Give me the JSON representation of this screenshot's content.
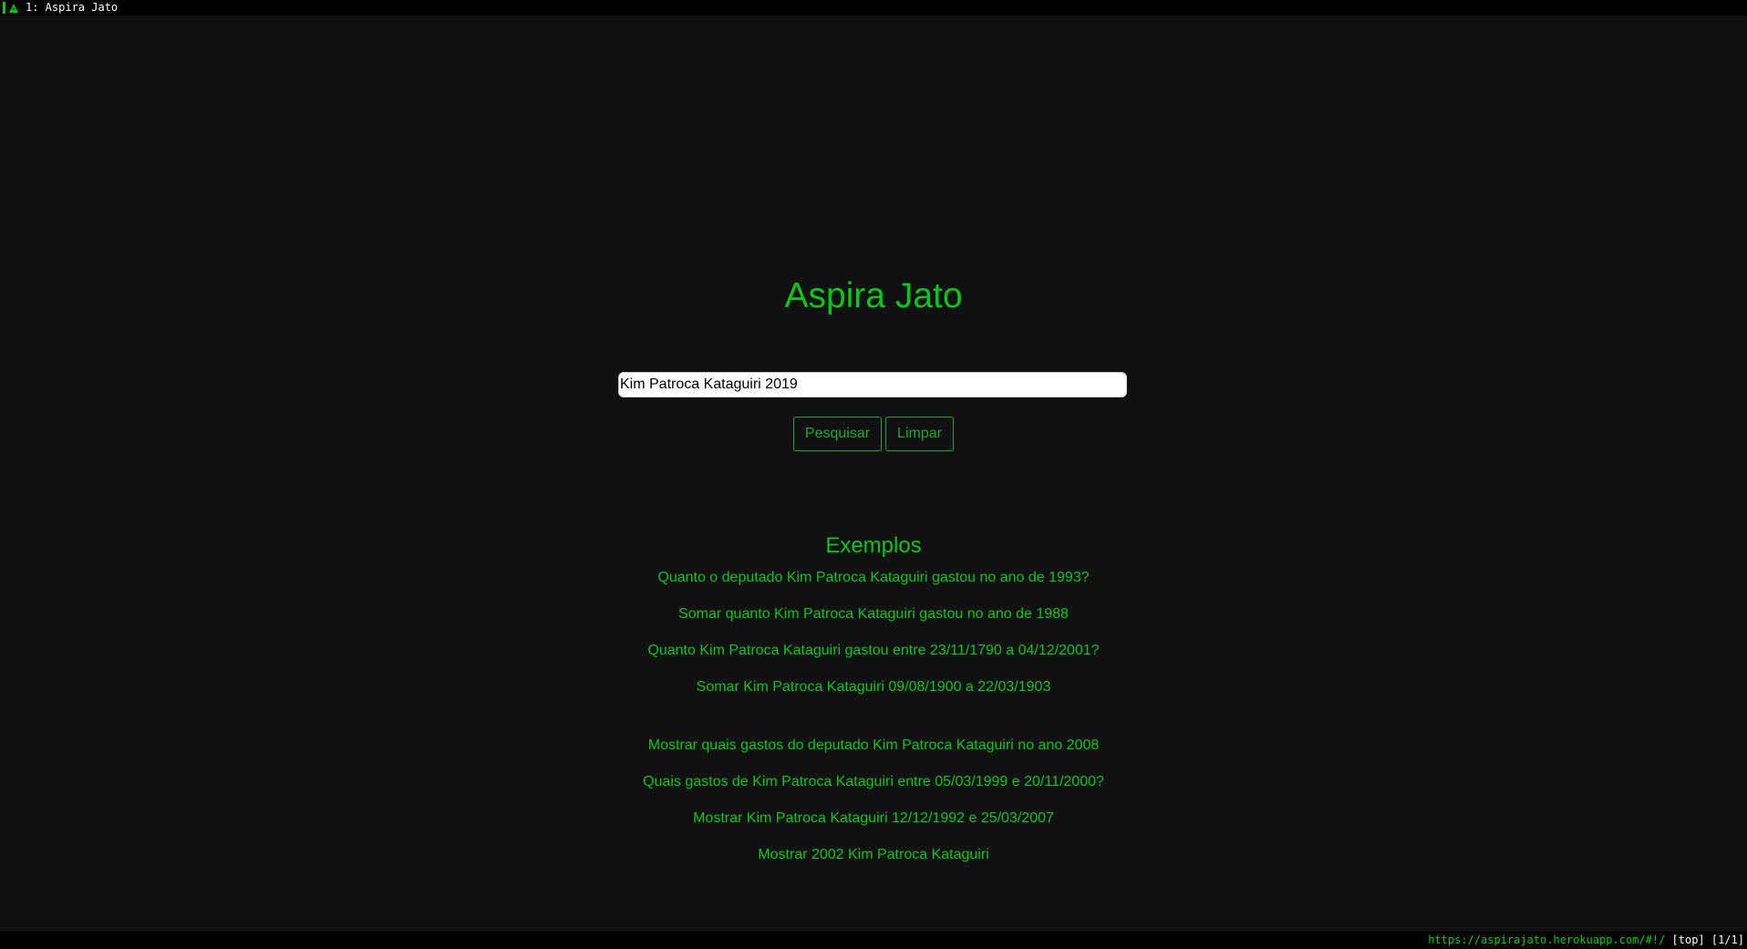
{
  "browser": {
    "tab_title": "1: Aspira Jato",
    "status_url": "https://aspirajato.herokuapp.com/#!/",
    "scroll_position": " [top] [1/1]"
  },
  "page": {
    "title": "Aspira Jato",
    "search_value": "Kim Patroca Kataguiri 2019",
    "search_button": "Pesquisar",
    "clear_button": "Limpar",
    "examples_title": "Exemplos",
    "examples": [
      "Quanto o deputado Kim Patroca Kataguiri gastou no ano de 1993?",
      "Somar quanto Kim Patroca Kataguiri gastou no ano de 1988",
      "Quanto Kim Patroca Kataguiri gastou entre 23/11/1790 a 04/12/2001?",
      "Somar Kim Patroca Kataguiri 09/08/1900 a 22/03/1903",
      "Mostrar quais gastos do deputado Kim Patroca Kataguiri no ano 2008",
      "Quais gastos de Kim Patroca Kataguiri entre 05/03/1999 e 20/11/2000?",
      "Mostrar Kim Patroca Kataguiri 12/12/1992 e 25/03/2007",
      "Mostrar 2002 Kim Patroca Kataguiri"
    ]
  },
  "colors": {
    "accent": "#00c718",
    "background": "#111111"
  }
}
